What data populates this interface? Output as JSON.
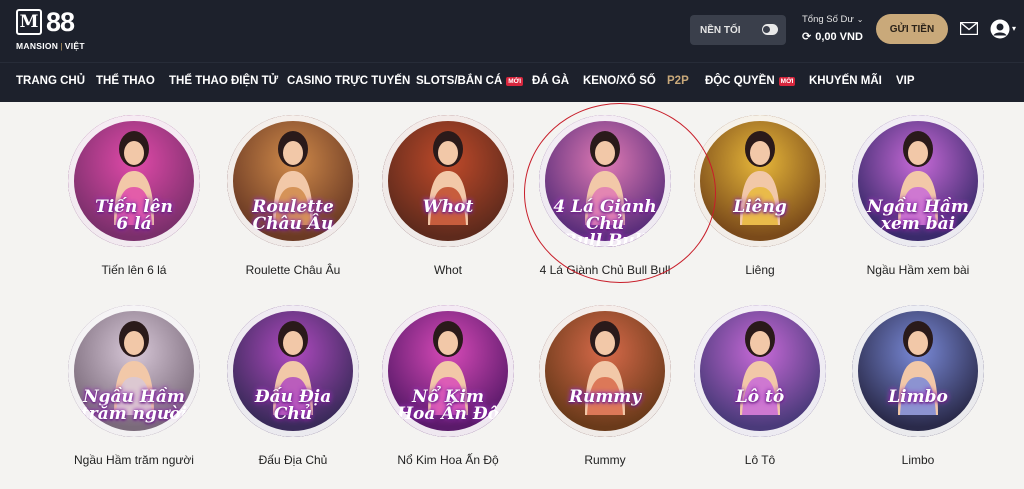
{
  "brand": {
    "mark": "M",
    "number": "88",
    "sub_left": "MANSION",
    "sub_sep": "|",
    "sub_right": "VIỆT"
  },
  "header": {
    "dark_mode_label": "NỀN TỐI",
    "balance_label": "Tổng Số Dư",
    "balance_value": "0,00 VND",
    "deposit_label": "GỬI TIỀN",
    "icons": {
      "mail": "mail-icon",
      "user": "user-icon",
      "refresh": "refresh-icon"
    }
  },
  "nav": [
    {
      "label": "TRANG CHỦ"
    },
    {
      "label": "THỂ THAO"
    },
    {
      "label": "THỂ THAO ĐIỆN TỬ"
    },
    {
      "label": "CASINO TRỰC TUYẾN"
    },
    {
      "label": "SLOTS/BẮN CÁ",
      "badge": "MỚI"
    },
    {
      "label": "ĐÁ GÀ"
    },
    {
      "label": "KENO/XỔ SỐ"
    },
    {
      "label": "P2P"
    },
    {
      "label": "ĐỘC QUYỀN",
      "badge": "MỚI"
    },
    {
      "label": "KHUYẾN MÃI"
    },
    {
      "label": "VIP"
    }
  ],
  "games": [
    {
      "label": "Tiến lên 6 lá",
      "art_text": "Tiến lên\n6 lá",
      "bg": "#7a2f6b",
      "accent": "#e14aa9"
    },
    {
      "label": "Roulette Châu Âu",
      "art_text": "Roulette\nChâu Âu",
      "bg": "#6b3a24",
      "accent": "#d08a4a"
    },
    {
      "label": "Whot",
      "art_text": "Whot",
      "bg": "#5e2a1c",
      "accent": "#c04a2a"
    },
    {
      "label": "4 Lá Giành Chủ Bull Bull",
      "art_text": "4 Lá Giành Chủ\nBull Bull",
      "bg": "#5a2e7a",
      "accent": "#e07ab4"
    },
    {
      "label": "Liêng",
      "art_text": "Liêng",
      "bg": "#7a4a1a",
      "accent": "#e8b83a"
    },
    {
      "label": "Ngầu Hầm xem bài",
      "art_text": "Ngầu Hầm\nxem bài",
      "bg": "#3a2a6b",
      "accent": "#c86ad8"
    },
    {
      "label": "Ngầu Hầm trăm người",
      "art_text": "Ngầu Hầm\ntrăm người",
      "bg": "#7a6a7a",
      "accent": "#d8c8d8"
    },
    {
      "label": "Đấu Địa Chủ",
      "art_text": "Đấu Địa Chủ",
      "bg": "#3a2a5a",
      "accent": "#b04ac0"
    },
    {
      "label": "Nổ Kim Hoa Ấn Độ",
      "art_text": "Nổ Kim\nHoa Ấn Độ",
      "bg": "#5a1a6a",
      "accent": "#d84ab8"
    },
    {
      "label": "Rummy",
      "art_text": "Rummy",
      "bg": "#6a3a1a",
      "accent": "#d86a4a"
    },
    {
      "label": "Lô Tô",
      "art_text": "Lô tô",
      "bg": "#4a3a7a",
      "accent": "#c86ad8"
    },
    {
      "label": "Limbo",
      "art_text": "Limbo",
      "bg": "#2a2a4a",
      "accent": "#7a8ad8"
    }
  ]
}
